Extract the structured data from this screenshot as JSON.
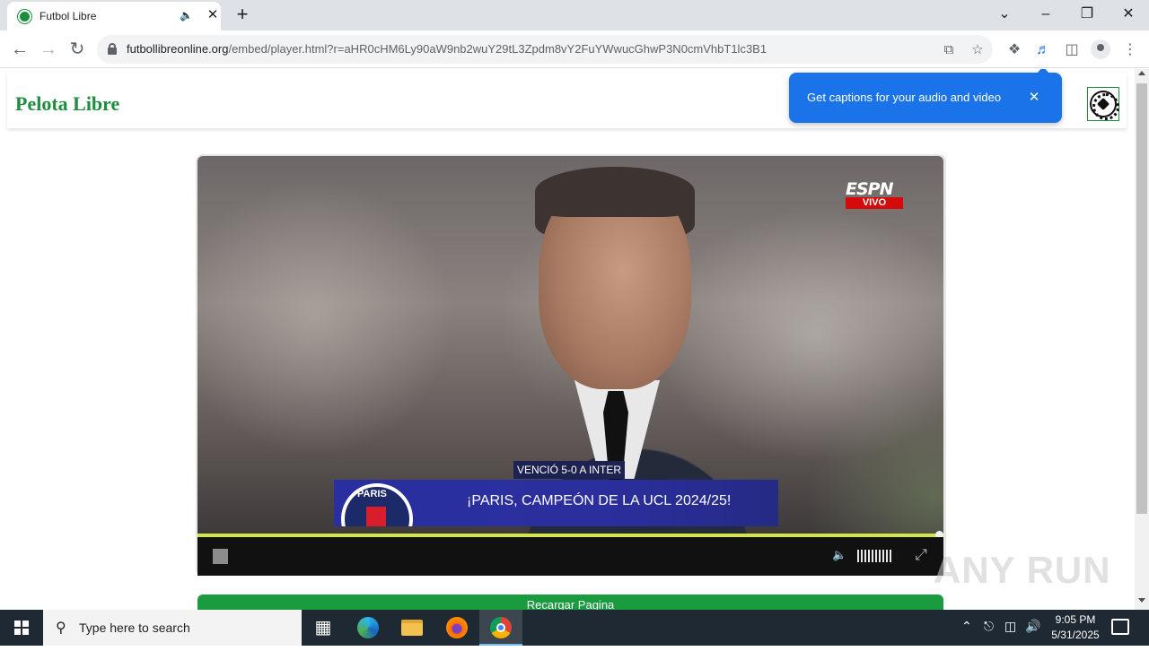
{
  "browser": {
    "tab": {
      "title": "Futbol Libre"
    },
    "url": {
      "host": "futbollibreonline.org",
      "path": "/embed/player.html?r=aHR0cHM6Ly90aW9nb2wuY29tL3Zpdm8vY2FuYWwucGhwP3N0cmVhbT1lc3B1"
    }
  },
  "site": {
    "brand": "Pelota Libre",
    "logo_icon": "soccer-ball-icon"
  },
  "captions_popup": {
    "message": "Get captions for your audio and video"
  },
  "video": {
    "broadcaster": "ESPN",
    "live_badge": "VIVO",
    "lower_third_sub": "VENCIÓ 5-0 A INTER",
    "lower_third_headline": "¡PARIS, CAMPEÓN DE LA UCL 2024/25!",
    "team_badge_text": "PARIS",
    "progress": 1.0
  },
  "reload_button": {
    "label": "Recargar Pagina"
  },
  "watermark": "ANY RUN",
  "taskbar": {
    "search_placeholder": "Type here to search",
    "time": "9:05 PM",
    "date": "5/31/2025"
  },
  "colors": {
    "brand_green": "#1e8e3e",
    "popup_blue": "#1a73e8",
    "progress_yellow": "#d4e645",
    "reload_green": "#1a9b40"
  }
}
